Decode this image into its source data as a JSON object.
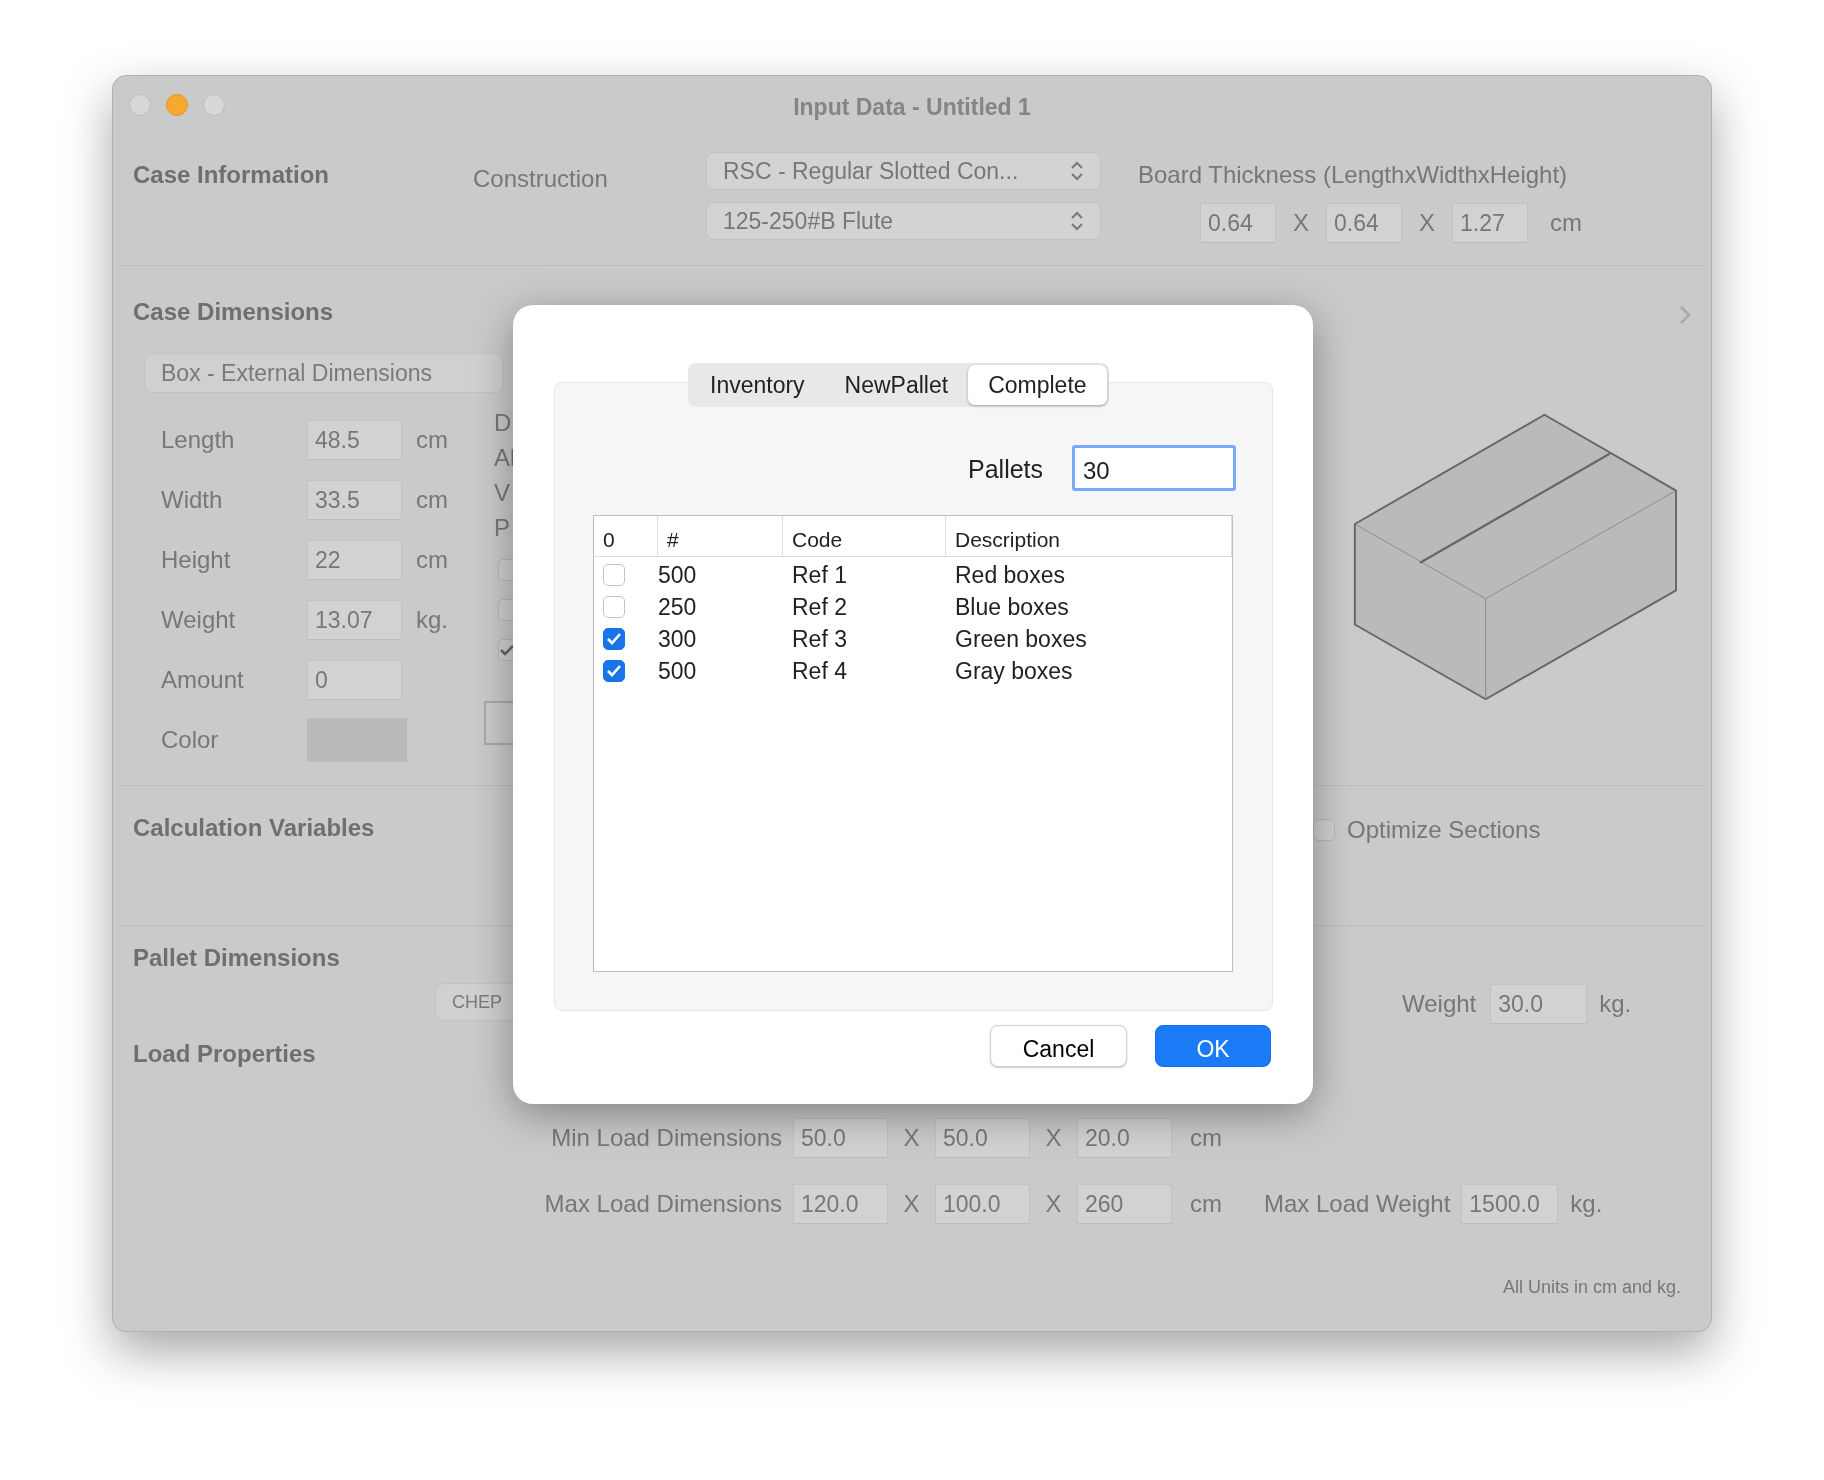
{
  "window": {
    "title": "Input Data - Untitled 1"
  },
  "case_information": {
    "heading": "Case Information",
    "construction_label": "Construction",
    "construction_select": "RSC - Regular Slotted Con...",
    "flute_select": "125-250#B Flute",
    "board_thickness_label": "Board Thickness (LengthxWidthxHeight)",
    "values": [
      "0.64",
      "0.64",
      "1.27"
    ],
    "separators": [
      "X",
      "X"
    ],
    "unit": "cm"
  },
  "case_dimensions": {
    "heading": "Case Dimensions",
    "mode_button": "Box - External Dimensions",
    "rows": [
      {
        "kind": "field",
        "label": "Length",
        "value": "48.5",
        "unit": "cm"
      },
      {
        "kind": "field",
        "label": "Width",
        "value": "33.5",
        "unit": "cm"
      },
      {
        "kind": "field",
        "label": "Height",
        "value": "22",
        "unit": "cm"
      },
      {
        "kind": "field",
        "label": "Weight",
        "value": "13.07",
        "unit": "kg."
      },
      {
        "kind": "field",
        "label": "Amount",
        "value": "0"
      },
      {
        "kind": "color",
        "label": "Color",
        "color": "#bababa"
      }
    ],
    "partial_labels": [
      "D",
      "Al",
      "V",
      "P"
    ],
    "partial_checkboxes": [
      {
        "checked": false
      },
      {
        "checked": false
      },
      {
        "checked": true
      }
    ]
  },
  "calculation_variables": {
    "heading": "Calculation Variables",
    "optimize_sections": {
      "label": "Optimize Sections",
      "checked": false
    }
  },
  "pallet_dimensions": {
    "heading": "Pallet Dimensions",
    "pallet_button": "CHEP",
    "weight_label": "Weight",
    "weight": "30.0",
    "weight_unit": "kg."
  },
  "load_properties": {
    "heading": "Load Properties",
    "rows": [
      {
        "label": "Min Load Dimensions",
        "values": [
          "50.0",
          "50.0",
          "20.0"
        ],
        "separators": [
          "X",
          "X"
        ],
        "unit": "cm"
      },
      {
        "label": "Max Load Dimensions",
        "values": [
          "120.0",
          "100.0",
          "260"
        ],
        "separators": [
          "X",
          "X"
        ],
        "unit": "cm"
      }
    ],
    "max_load_weight_label": "Max Load Weight",
    "max_load_weight": "1500.0",
    "max_load_weight_unit": "kg."
  },
  "footer_note": "All Units in cm and kg.",
  "dialog": {
    "tabs": [
      {
        "label": "Inventory",
        "selected": false
      },
      {
        "label": "NewPallet",
        "selected": false
      },
      {
        "label": "Complete",
        "selected": true
      }
    ],
    "pallets_label": "Pallets",
    "pallets_value": "30",
    "table": {
      "columns": [
        "0",
        "#",
        "Code",
        "Description"
      ],
      "rows": [
        {
          "checked": false,
          "count": "500",
          "code": "Ref 1",
          "description": "Red boxes"
        },
        {
          "checked": false,
          "count": "250",
          "code": "Ref 2",
          "description": "Blue boxes"
        },
        {
          "checked": true,
          "count": "300",
          "code": "Ref 3",
          "description": "Green boxes"
        },
        {
          "checked": true,
          "count": "500",
          "code": "Ref 4",
          "description": "Gray boxes"
        }
      ]
    },
    "buttons": [
      {
        "label": "Cancel",
        "kind": "secondary"
      },
      {
        "label": "OK",
        "kind": "primary"
      }
    ]
  }
}
